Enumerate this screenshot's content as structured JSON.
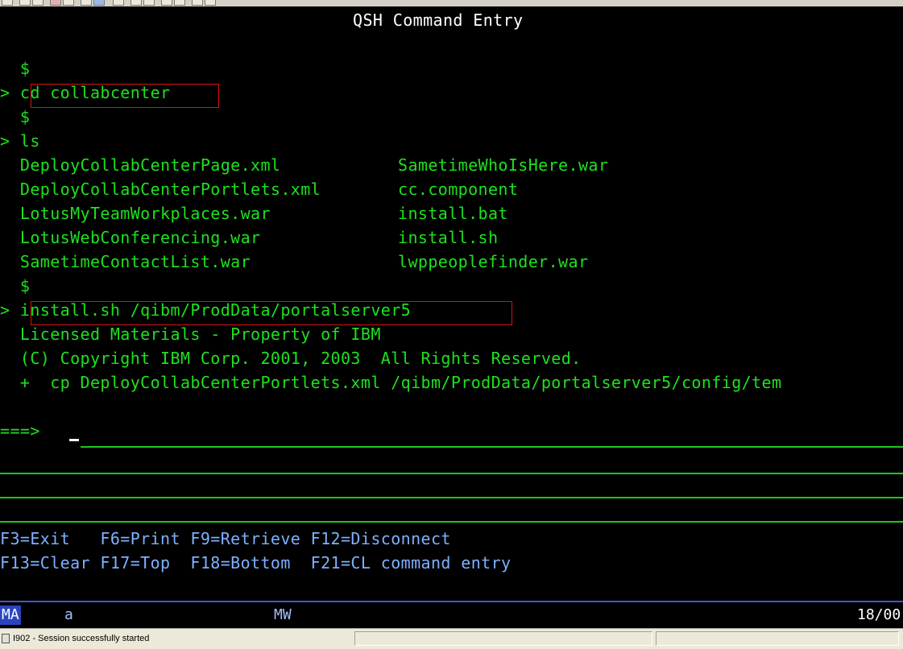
{
  "screen": {
    "title": "QSH Command Entry",
    "lines": [
      {
        "text": "  $",
        "color": "green"
      },
      {
        "text": "> cd collabcenter",
        "color": "green"
      },
      {
        "text": "  $",
        "color": "green"
      },
      {
        "text": "> ls",
        "color": "green"
      },
      {
        "text": "  $",
        "color": "green"
      },
      {
        "text": "> install.sh /qibm/ProdData/portalserver5",
        "color": "green"
      },
      {
        "text": "  Licensed Materials - Property of IBM",
        "color": "green"
      },
      {
        "text": "  (C) Copyright IBM Corp. 2001, 2003  All Rights Reserved.",
        "color": "green"
      },
      {
        "text": "  +  cp DeployCollabCenterPortlets.xml /qibm/ProdData/portalserver5/config/tem",
        "color": "green"
      }
    ],
    "ls_left": [
      "  DeployCollabCenterPage.xml",
      "  DeployCollabCenterPortlets.xml",
      "  LotusMyTeamWorkplaces.war",
      "  LotusWebConferencing.war",
      "  SametimeContactList.war"
    ],
    "ls_right": [
      "SametimeWhoIsHere.war",
      "cc.component",
      "install.bat",
      "install.sh",
      "lwppeoplefinder.war"
    ],
    "prompt": "===>",
    "fkeys_line1": "F3=Exit   F6=Print F9=Retrieve F12=Disconnect",
    "fkeys_line2": "F13=Clear F17=Top  F18=Bottom  F21=CL command entry"
  },
  "oia": {
    "indicator": "MA",
    "field_a": "a",
    "mode": "MW",
    "position": "18/00"
  },
  "statusbar": {
    "message": "I902 - Session successfully started"
  },
  "colors": {
    "background": "#000000",
    "green": "#1ee11e",
    "blue_text": "#7fb0ff",
    "highlight_box": "#e01010"
  }
}
